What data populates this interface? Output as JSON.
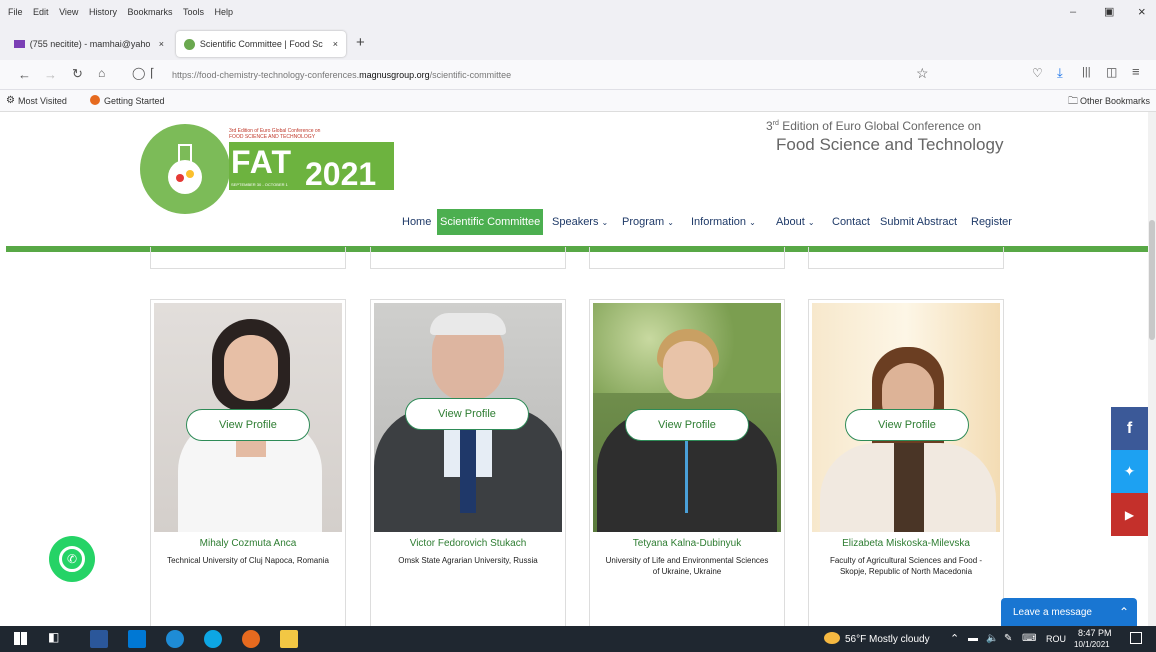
{
  "menubar": {
    "items": [
      "File",
      "Edit",
      "View",
      "History",
      "Bookmarks",
      "Tools",
      "Help"
    ]
  },
  "tabs": [
    {
      "label": "(755 necitite) - mamhai@yaho"
    },
    {
      "label": "Scientific Committee | Food Sc"
    }
  ],
  "url": {
    "host_prefix": "https://food-chemistry-technology-conferences.",
    "domain": "magnusgroup.org",
    "path": "/scientific-committee"
  },
  "bookmarks": {
    "most_visited": "Most Visited",
    "getting_started": "Getting Started",
    "other": "Other Bookmarks"
  },
  "logo": {
    "small_line1": "3rd Edition of Euro Global Conference on",
    "small_line2": "FOOD SCIENCE AND TECHNOLOGY",
    "fat": "FAT",
    "year": "2021",
    "dates": "SEPTEMBER 30 - OCTOBER 1"
  },
  "header": {
    "edition_sup": "rd",
    "edition_line1_prefix": "3",
    "edition_line1": " Edition of Euro Global Conference on",
    "edition_line2": "Food Science and Technology"
  },
  "nav": [
    {
      "label": "Home"
    },
    {
      "label": "Scientific Committee"
    },
    {
      "label": "Speakers"
    },
    {
      "label": "Program"
    },
    {
      "label": "Information"
    },
    {
      "label": "About"
    },
    {
      "label": "Contact"
    },
    {
      "label": "Submit Abstract"
    },
    {
      "label": "Register"
    }
  ],
  "members": [
    {
      "name": "Mihaly Cozmuta Anca",
      "affiliation": "Technical University of Cluj Napoca, Romania",
      "button": "View Profile"
    },
    {
      "name": "Victor Fedorovich Stukach",
      "affiliation": "Omsk State Agrarian University, Russia",
      "button": "View Profile"
    },
    {
      "name": "Tetyana Kalna-Dubinyuk",
      "affiliation": "University of Life and Environmental Sciences of Ukraine, Ukraine",
      "button": "View Profile"
    },
    {
      "name": "Elizabeta Miskoska-Milevska",
      "affiliation": "Faculty of Agricultural Sciences and Food - Skopje, Republic of North Macedonia",
      "button": "View Profile"
    }
  ],
  "chat": {
    "label": "Leave a message"
  },
  "taskbar": {
    "weather": "56°F  Mostly cloudy",
    "lang": "ROU",
    "time": "8:47 PM",
    "date": "10/1/2021"
  },
  "colors": {
    "green": "#58a846",
    "nav_active_bg": "#4caf50",
    "nav_text": "#1f3a68",
    "facebook": "#3b5998",
    "twitter": "#1da1f2",
    "youtube": "#c4302b",
    "whatsapp": "#25d366",
    "chat": "#1976d2"
  }
}
